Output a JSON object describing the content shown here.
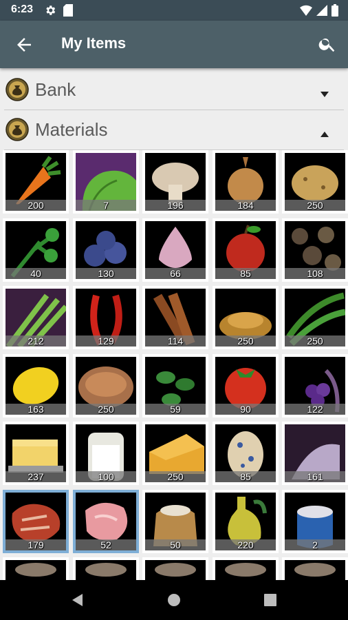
{
  "status": {
    "time": "6:23",
    "icons": [
      "gear-icon",
      "sd-card-icon",
      "wifi-icon",
      "signal-icon",
      "battery-icon"
    ]
  },
  "app_bar": {
    "title": "My Items",
    "back_icon": "arrow-back-icon",
    "search_icon": "search-icon"
  },
  "sections": [
    {
      "label": "Bank",
      "icon": "money-bag-icon",
      "state": "collapsed"
    },
    {
      "label": "Materials",
      "icon": "money-bag-icon",
      "state": "expanded"
    }
  ],
  "items": [
    {
      "icon": "carrot-icon",
      "quantity": "200"
    },
    {
      "icon": "lettuce-icon",
      "quantity": "7"
    },
    {
      "icon": "mushroom-icon",
      "quantity": "196"
    },
    {
      "icon": "onion-icon",
      "quantity": "184"
    },
    {
      "icon": "potato-icon",
      "quantity": "250"
    },
    {
      "icon": "parsley-icon",
      "quantity": "40"
    },
    {
      "icon": "blueberries-icon",
      "quantity": "130"
    },
    {
      "icon": "garlic-icon",
      "quantity": "66"
    },
    {
      "icon": "apple-icon",
      "quantity": "85"
    },
    {
      "icon": "seeds-icon",
      "quantity": "108"
    },
    {
      "icon": "celery-icon",
      "quantity": "212"
    },
    {
      "icon": "chili-pepper-icon",
      "quantity": "129"
    },
    {
      "icon": "cinnamon-icon",
      "quantity": "114"
    },
    {
      "icon": "spice-powder-icon",
      "quantity": "250"
    },
    {
      "icon": "green-beans-icon",
      "quantity": "250"
    },
    {
      "icon": "lemon-icon",
      "quantity": "163"
    },
    {
      "icon": "dough-icon",
      "quantity": "250"
    },
    {
      "icon": "herb-leaves-icon",
      "quantity": "59"
    },
    {
      "icon": "tomato-icon",
      "quantity": "90"
    },
    {
      "icon": "grapes-icon",
      "quantity": "122"
    },
    {
      "icon": "butter-icon",
      "quantity": "237"
    },
    {
      "icon": "milk-jar-icon",
      "quantity": "100"
    },
    {
      "icon": "cheese-icon",
      "quantity": "250"
    },
    {
      "icon": "egg-icon",
      "quantity": "85"
    },
    {
      "icon": "salt-icon",
      "quantity": "161"
    },
    {
      "icon": "steak-icon",
      "quantity": "179",
      "selected": true
    },
    {
      "icon": "raw-meat-icon",
      "quantity": "52",
      "selected": true
    },
    {
      "icon": "flour-sack-icon",
      "quantity": "50"
    },
    {
      "icon": "oil-bottle-icon",
      "quantity": "220"
    },
    {
      "icon": "salt-jar-icon",
      "quantity": "2"
    },
    {
      "icon": "item-icon",
      "quantity": ""
    },
    {
      "icon": "item-icon",
      "quantity": ""
    },
    {
      "icon": "item-icon",
      "quantity": ""
    },
    {
      "icon": "item-icon",
      "quantity": ""
    },
    {
      "icon": "item-icon",
      "quantity": ""
    }
  ],
  "nav": {
    "icons": [
      "back-triangle-icon",
      "home-circle-icon",
      "recents-square-icon"
    ]
  },
  "colors": {
    "status_bar": "#3b4c56",
    "app_bar": "#4d6068",
    "background": "#eeeeee",
    "selection": "#7eaed6"
  }
}
